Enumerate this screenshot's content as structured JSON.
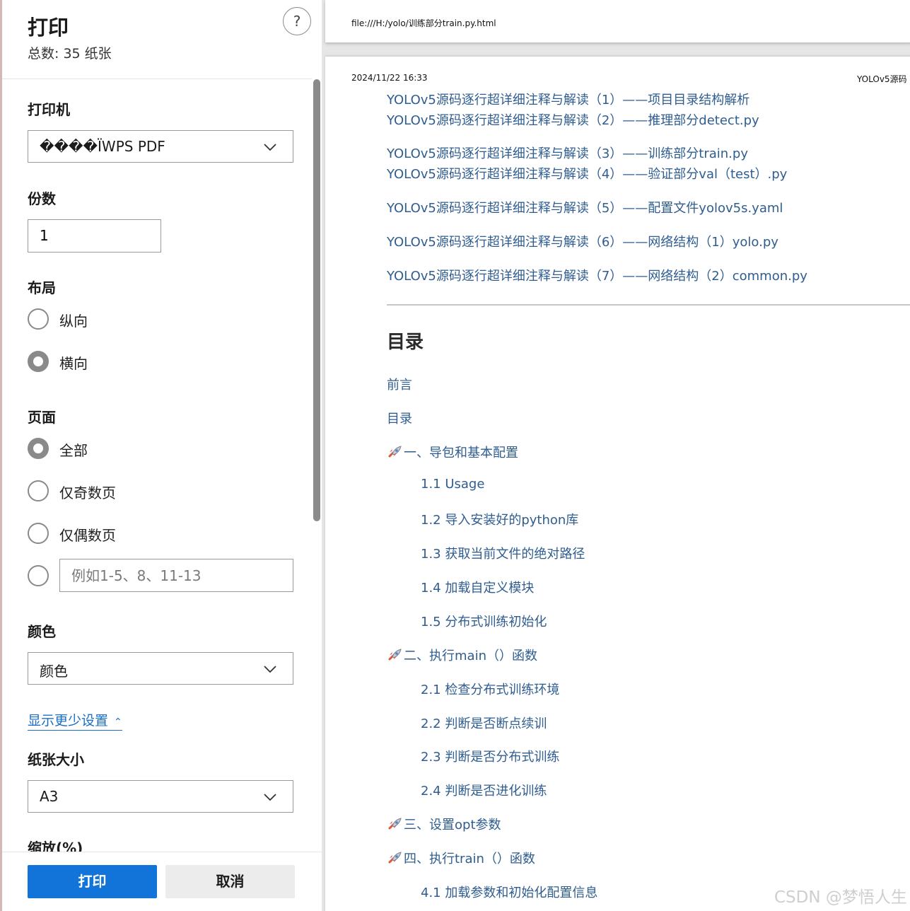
{
  "panel": {
    "title": "打印",
    "subtitle": "总数: 35 纸张",
    "help": "?",
    "printer": {
      "label": "打印机",
      "value": "����ÏWPS PDF"
    },
    "copies": {
      "label": "份数",
      "value": "1"
    },
    "layout": {
      "label": "布局",
      "options": [
        "纵向",
        "横向"
      ],
      "selected": "横向"
    },
    "pages": {
      "label": "页面",
      "options": [
        "全部",
        "仅奇数页",
        "仅偶数页"
      ],
      "selected": "全部",
      "range_placeholder": "例如1-5、8、11-13"
    },
    "color": {
      "label": "颜色",
      "value": "颜色"
    },
    "more_settings": "显示更少设置",
    "paper": {
      "label": "纸张大小",
      "value": "A3"
    },
    "scale": {
      "label": "缩放(%)"
    },
    "print_button": "打印",
    "cancel_button": "取消"
  },
  "preview": {
    "page1_url": "file:///H:/yolo/训练部分train.py.html",
    "header_date": "2024/11/22 16:33",
    "header_title": "YOLOv5源码",
    "series": [
      "YOLOv5源码逐行超详细注释与解读（1）——项目目录结构解析",
      "YOLOv5源码逐行超详细注释与解读（2）——推理部分detect.py",
      "YOLOv5源码逐行超详细注释与解读（3）——训练部分train.py",
      "YOLOv5源码逐行超详细注释与解读（4）——验证部分val（test）.py",
      "YOLOv5源码逐行超详细注释与解读（5）——配置文件yolov5s.yaml",
      "YOLOv5源码逐行超详细注释与解读（6）——网络结构（1）yolo.py",
      "YOLOv5源码逐行超详细注释与解读（7）——网络结构（2）common.py"
    ],
    "toc_heading": "目录",
    "toc": [
      {
        "text": "前言",
        "level": 1,
        "rocket": false
      },
      {
        "text": "目录",
        "level": 1,
        "rocket": false
      },
      {
        "text": "一、导包和基本配置",
        "level": 1,
        "rocket": true
      },
      {
        "text": "1.1 Usage",
        "level": 2,
        "rocket": false
      },
      {
        "text": "1.2 导入安装好的python库",
        "level": 2,
        "rocket": false
      },
      {
        "text": "1.3 获取当前文件的绝对路径",
        "level": 2,
        "rocket": false
      },
      {
        "text": "1.4 加载自定义模块",
        "level": 2,
        "rocket": false
      },
      {
        "text": "1.5 分布式训练初始化",
        "level": 2,
        "rocket": false
      },
      {
        "text": "二、执行main（）函数",
        "level": 1,
        "rocket": true
      },
      {
        "text": "2.1 检查分布式训练环境",
        "level": 2,
        "rocket": false
      },
      {
        "text": "2.2 判断是否断点续训",
        "level": 2,
        "rocket": false
      },
      {
        "text": "2.3 判断是否分布式训练",
        "level": 2,
        "rocket": false
      },
      {
        "text": "2.4  判断是否进化训练",
        "level": 2,
        "rocket": false
      },
      {
        "text": "三、设置opt参数",
        "level": 1,
        "rocket": true
      },
      {
        "text": "四、执行train（）函数",
        "level": 1,
        "rocket": true
      },
      {
        "text": "4.1 加载参数和初始化配置信息",
        "level": 2,
        "rocket": false
      }
    ],
    "watermark": "CSDN @梦悟人生"
  },
  "colors": {
    "accent": "#1274d9",
    "link": "#2f5d8f",
    "more_link": "#1a6ec8",
    "radio": "#8a8a8a"
  }
}
